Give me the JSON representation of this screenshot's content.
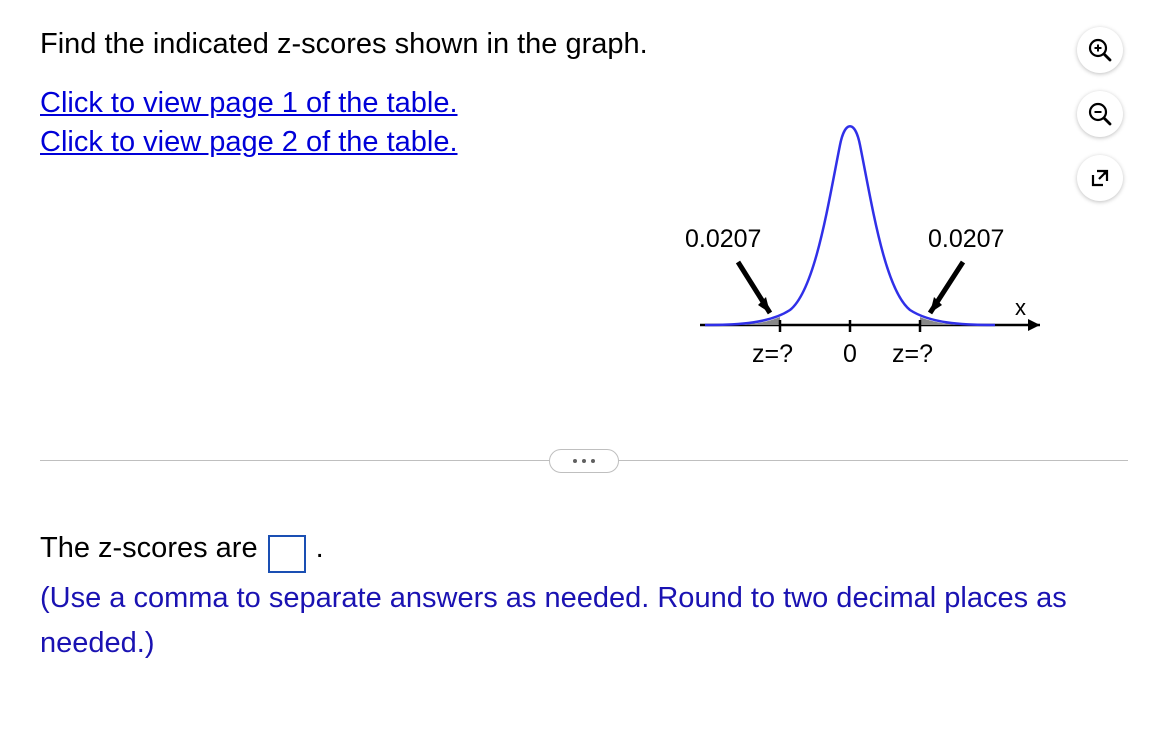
{
  "question": {
    "prompt": "Find the indicated z-scores shown in the graph.",
    "link1": "Click to view page 1 of the table.",
    "link2": "Click to view page 2 of the table."
  },
  "chart_data": {
    "type": "area",
    "title": "",
    "xlabel": "x",
    "ylabel": "",
    "annotations": {
      "left_area": "0.0207",
      "right_area": "0.0207"
    },
    "x_ticks": [
      "z=?",
      "0",
      "z=?"
    ],
    "curve": "standard_normal",
    "shaded_tails": true,
    "tail_area_each": 0.0207
  },
  "answer": {
    "stem": "The z-scores are",
    "period": ".",
    "instruction": "(Use a comma to separate answers as needed. Round to two decimal places as needed.)"
  },
  "icons": {
    "zoom_in": "zoom-in",
    "zoom_out": "zoom-out",
    "popout": "popout"
  }
}
